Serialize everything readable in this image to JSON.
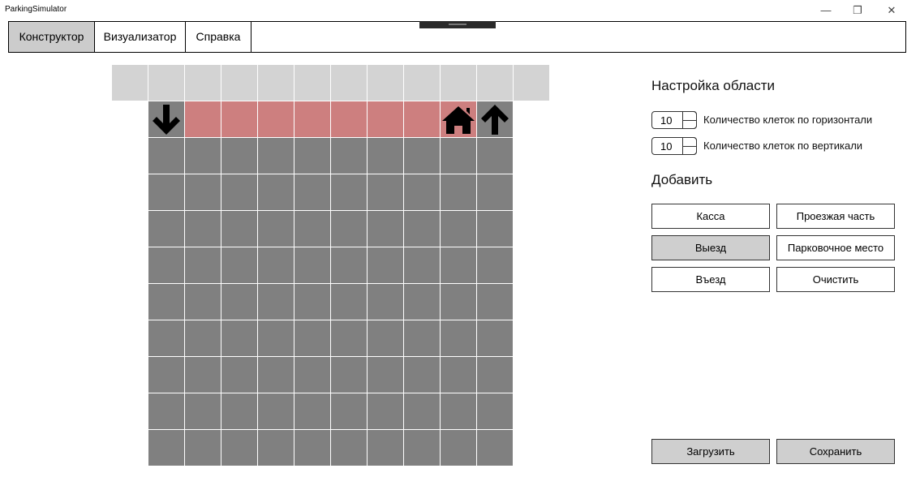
{
  "window": {
    "title": "ParkingSimulator",
    "minimize_glyph": "—",
    "restore_glyph": "❐",
    "close_glyph": "✕"
  },
  "tabs": [
    {
      "label": "Конструктор",
      "active": true
    },
    {
      "label": "Визуализатор",
      "active": false
    },
    {
      "label": "Справка",
      "active": false
    }
  ],
  "grid": {
    "header_cells": 12,
    "columns": 10,
    "rows": 10,
    "road_row_icons": [
      "arrow-down-icon",
      "house-icon",
      "arrow-up-icon"
    ],
    "colors": {
      "header": "#d3d3d3",
      "cell": "#808080",
      "road": "#cd7f7f"
    }
  },
  "settings": {
    "title": "Настройка области",
    "horizontal": {
      "value": "10",
      "label": "Количество клеток по горизонтали"
    },
    "vertical": {
      "value": "10",
      "label": "Количество клеток по вертикали"
    }
  },
  "add": {
    "title": "Добавить",
    "cashier": "Касса",
    "road": "Проезжая часть",
    "exit": "Выезд",
    "parking": "Парковочное место",
    "entry": "Въезд",
    "clear": "Очистить"
  },
  "footer": {
    "load": "Загрузить",
    "save": "Сохранить"
  }
}
